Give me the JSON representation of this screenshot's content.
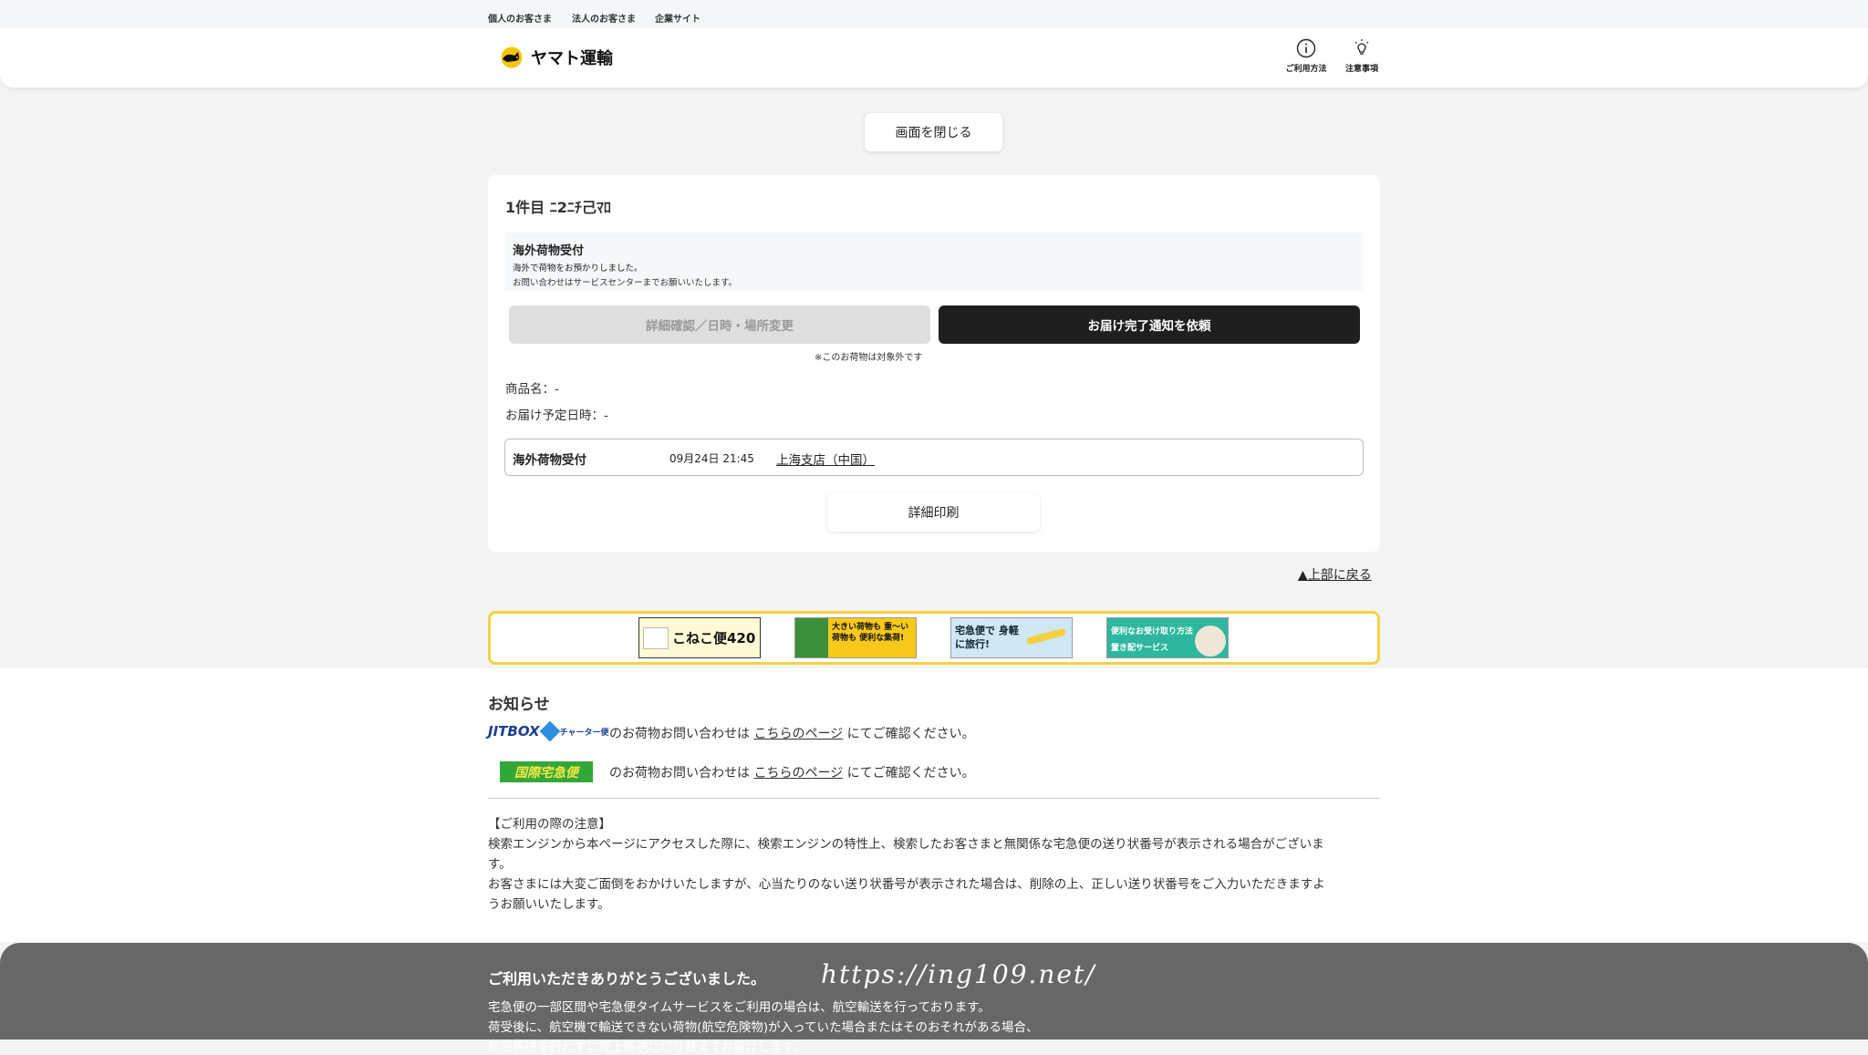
{
  "util_nav": [
    "個人のお客さま",
    "法人のお客さま",
    "企業サイト"
  ],
  "header": {
    "logo_text": "ヤマト運輸",
    "nav": [
      {
        "label": "ご利用方法",
        "icon": "info-icon"
      },
      {
        "label": "注意事項",
        "icon": "lightbulb-icon"
      }
    ]
  },
  "close_button": "画面を閉じる",
  "card": {
    "title": "1件目 ﾆ2ﾆﾁ己ﾏﾛ",
    "notice_title": "海外荷物受付",
    "notice_line1": "海外で荷物をお預かりしました。",
    "notice_line2": "お問い合わせはサービスセンターまでお願いいたします。",
    "btn_detail": "詳細確認／日時・場所変更",
    "btn_notify": "お届け完了通知を依頼",
    "note_small": "※このお荷物は対象外です",
    "product_label": "商品名：-",
    "delivery_label": "お届け予定日時：-",
    "status": {
      "name": "海外荷物受付",
      "datetime": "09月24日 21:45",
      "location": "上海支店（中国）"
    },
    "print_button": "詳細印刷"
  },
  "to_top": "▲上部に戻る",
  "banners": [
    {
      "text": "こねこ便420"
    },
    {
      "text": "大きい荷物も 重～い荷物も 便利な集荷!"
    },
    {
      "text": "宅急便で 身軽に旅行!"
    },
    {
      "text": "便利なお受け取り方法 置き配サービス"
    }
  ],
  "news": {
    "title": "お知らせ",
    "jitbox_logo": "JITBOX",
    "jitbox_sub": "チャーター便",
    "kokusai_logo": "国際宅急便",
    "line_pre": "のお荷物お問い合わせは",
    "line_link": "こちらのページ",
    "line_post": "にてご確認ください。"
  },
  "caution": {
    "heading": "【ご利用の際の注意】",
    "p1a": "検索エンジンから本ページにアクセスした際に、検索エンジンの特性上、検索したお客さまと無関係な宅急便の送り状番号が表示される場合がございま",
    "p1b": "す。",
    "p2a": "お客さまには大変ご面倒をおかけいたしますが、心当たりのない送り状番号が表示された場合は、削除の上、正しい送り状番号をご入力いただきますよ",
    "p2b": "うお願いいたします。"
  },
  "footer": {
    "title": "ご利用いただきありがとうございました。",
    "watermark": "https://ing109.net/",
    "line1": "宅急便の一部区間や宅急便タイムサービスをご利用の場合は、航空輸送を行っております。",
    "line2": "荷受後に、航空機で輸送できない荷物(航空危険物)が入っていた場合またはそのおそれがある場合、",
    "line3": "航空輸送を行わずに陸上輸送に切り替えてお届けします。"
  }
}
